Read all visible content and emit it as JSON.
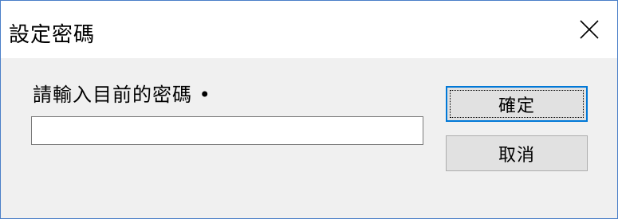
{
  "window": {
    "title": "設定密碼",
    "close_label": "×"
  },
  "dialog": {
    "prompt": "請輸入目前的密碼 •",
    "password": {
      "value": "",
      "placeholder": ""
    }
  },
  "buttons": {
    "ok_label": "確定",
    "cancel_label": "取消"
  },
  "colors": {
    "window_border": "#4a7fc8",
    "titlebar_bg": "#ffffff",
    "client_bg": "#f0f0f0",
    "button_bg": "#e1e1e1",
    "default_button_border": "#0078d7"
  }
}
